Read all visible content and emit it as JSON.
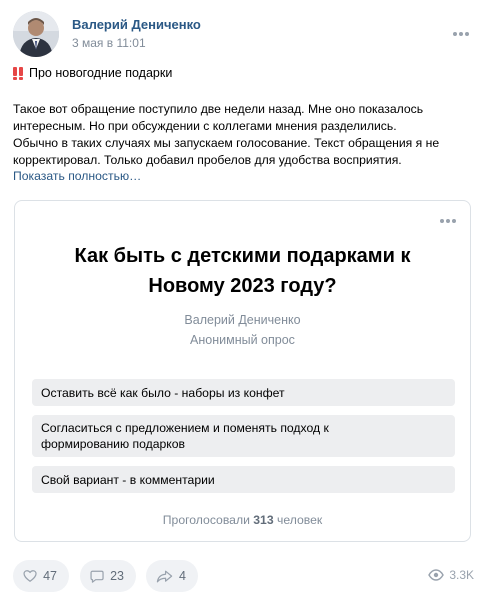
{
  "post": {
    "author": "Валерий Дениченко",
    "date": "3 мая в 11:01",
    "title": "Про новогодние подарки",
    "body_lines": [
      "Такое вот обращение поступило две недели назад. Мне оно показалось",
      "интересным. Но при обсуждении с коллегами мнения разделились.",
      "Обычно в таких случаях мы запускаем голосование. Текст обращения я не",
      "корректировал. Только добавил пробелов для удобства восприятия."
    ],
    "show_more": "Показать полностью…"
  },
  "poll": {
    "question_lines": [
      "Как быть с детскими подарками к",
      "Новому 2023 году?"
    ],
    "author": "Валерий Дениченко",
    "type": "Анонимный опрос",
    "options": [
      [
        "Оставить всё как было - наборы из конфет"
      ],
      [
        "Согласиться с предложением и поменять подход к",
        "формированию подарков"
      ],
      [
        "Свой вариант - в комментарии"
      ]
    ],
    "total_prefix": "Проголосовали",
    "total_count": "313",
    "total_suffix": "человек"
  },
  "actions": {
    "likes": "47",
    "comments": "23",
    "shares": "4",
    "views": "3.3K"
  },
  "icons": {
    "like": "heart-icon",
    "comment": "comment-icon",
    "share": "share-icon",
    "views": "eye-icon",
    "more": "more-horizontal-icon",
    "title_marker": "double-exclamation-icon"
  },
  "colors": {
    "link": "#2a5885",
    "muted": "#818c99",
    "option_bg": "#edeef0",
    "action_bg": "#f0f2f5",
    "exclamation": "#e64646"
  }
}
